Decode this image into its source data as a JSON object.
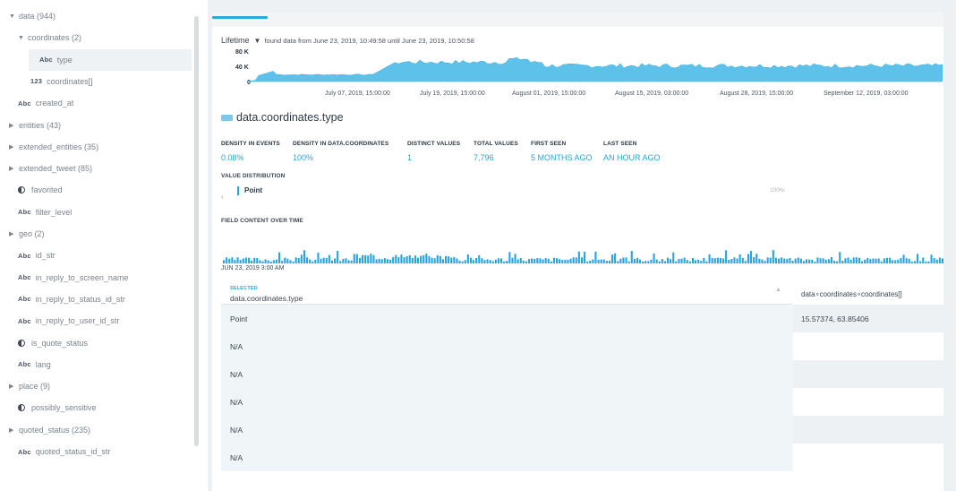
{
  "sidebar": {
    "items": [
      {
        "label": "data (944)",
        "kind": "expanded",
        "indent": 0
      },
      {
        "label": "coordinates (2)",
        "kind": "expanded",
        "indent": 1
      },
      {
        "label": "type",
        "kind": "abc",
        "indent": 2,
        "selected": true
      },
      {
        "label": "coordinates[]",
        "kind": "num",
        "indent": 2
      },
      {
        "label": "created_at",
        "kind": "abc",
        "indent": 1
      },
      {
        "label": "entities (43)",
        "kind": "collapsed",
        "indent": 0
      },
      {
        "label": "extended_entities (35)",
        "kind": "collapsed",
        "indent": 0
      },
      {
        "label": "extended_tweet (85)",
        "kind": "collapsed",
        "indent": 0
      },
      {
        "label": "favorited",
        "kind": "bool",
        "indent": 1
      },
      {
        "label": "filter_level",
        "kind": "abc",
        "indent": 1
      },
      {
        "label": "geo (2)",
        "kind": "collapsed",
        "indent": 0
      },
      {
        "label": "id_str",
        "kind": "abc",
        "indent": 1
      },
      {
        "label": "in_reply_to_screen_name",
        "kind": "abc",
        "indent": 1
      },
      {
        "label": "in_reply_to_status_id_str",
        "kind": "abc",
        "indent": 1
      },
      {
        "label": "in_reply_to_user_id_str",
        "kind": "abc",
        "indent": 1
      },
      {
        "label": "is_quote_status",
        "kind": "bool",
        "indent": 1
      },
      {
        "label": "lang",
        "kind": "abc",
        "indent": 1
      },
      {
        "label": "place (9)",
        "kind": "collapsed",
        "indent": 0
      },
      {
        "label": "possibly_sensitive",
        "kind": "bool",
        "indent": 1
      },
      {
        "label": "quoted_status (235)",
        "kind": "collapsed",
        "indent": 0
      },
      {
        "label": "quoted_status_id_str",
        "kind": "abc",
        "indent": 1
      }
    ],
    "badge_abc": "Abc",
    "badge_num": "123"
  },
  "overview": {
    "lifetime_label": "Lifetime",
    "range_text": "found data from June 23, 2019, 10:49:58 until June 23, 2019, 10:50:58",
    "y_ticks": [
      "80 K",
      "40 K",
      "0"
    ],
    "date_ticks": [
      "July 07, 2019, 15:00:00",
      "July 19, 2019, 15:00:00",
      "August 01, 2019, 15:00:00",
      "August 15, 2019, 03:00:00",
      "August 28, 2019, 15:00:00",
      "September 12, 2019, 03:00:00"
    ],
    "fill_color": "#5ec1ea"
  },
  "field": {
    "title": "data.coordinates.type",
    "stats": [
      {
        "label": "DENSITY IN EVENTS",
        "value": "0.08%"
      },
      {
        "label": "DENSITY IN DATA.COORDINATES",
        "value": "100%"
      },
      {
        "label": "DISTINCT VALUES",
        "value": "1"
      },
      {
        "label": "TOTAL VALUES",
        "value": "7,796"
      },
      {
        "label": "FIRST SEEN",
        "value": "5 MONTHS AGO"
      },
      {
        "label": "LAST SEEN",
        "value": "AN HOUR AGO"
      }
    ],
    "value_distribution_label": "VALUE DISTRIBUTION",
    "distribution": {
      "label": "Point",
      "percent": "100%"
    },
    "content_over_time_label": "FIELD CONTENT OVER TIME",
    "histogram_date": "JUN 23, 2019 3:00 AM"
  },
  "table": {
    "selected_tag": "SELECTED",
    "left_header": "data.coordinates.type",
    "right_header": "data∘coordinates∘coordinates[]",
    "rows": [
      {
        "left": "Point",
        "right": "15.57374, 63.85406"
      },
      {
        "left": "N/A",
        "right": ""
      },
      {
        "left": "N/A",
        "right": ""
      },
      {
        "left": "N/A",
        "right": ""
      },
      {
        "left": "N/A",
        "right": ""
      },
      {
        "left": "N/A",
        "right": ""
      }
    ]
  },
  "colors": {
    "accent": "#2aa4dc",
    "chart_fill": "#5ec1ea"
  }
}
